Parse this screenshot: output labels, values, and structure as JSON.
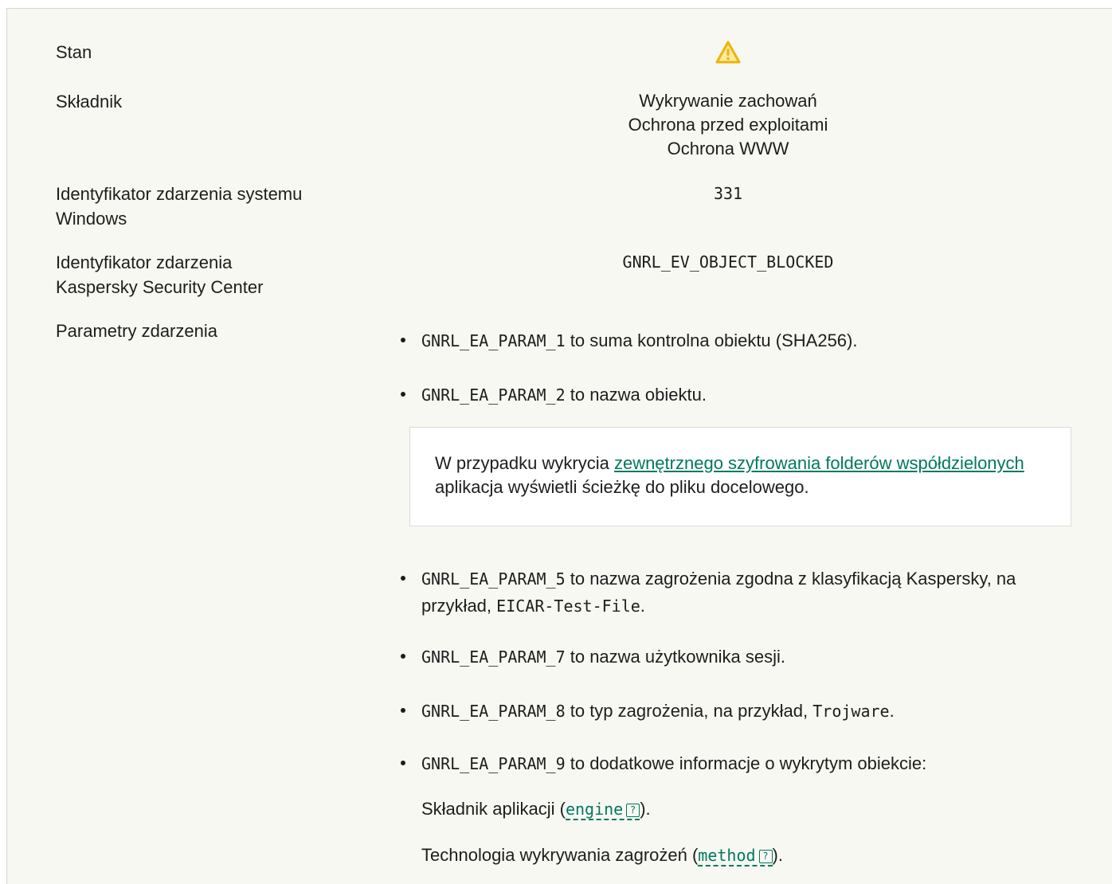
{
  "rows": {
    "stan": {
      "label": "Stan",
      "icon": "warning-icon"
    },
    "skladnik": {
      "label": "Składnik",
      "values": [
        "Wykrywanie zachowań",
        "Ochrona przed exploitami",
        "Ochrona WWW"
      ]
    },
    "windows_id": {
      "label_line1": "Identyfikator zdarzenia systemu",
      "label_line2": "Windows",
      "value": "331"
    },
    "ksc_id": {
      "label_line1": "Identyfikator zdarzenia",
      "label_line2": "Kaspersky Security Center",
      "value": "GNRL_EV_OBJECT_BLOCKED"
    },
    "params": {
      "label": "Parametry zdarzenia"
    }
  },
  "params": {
    "p1": {
      "code": "GNRL_EA_PARAM_1",
      "text": " to suma kontrolna obiektu (SHA256)."
    },
    "p2": {
      "code": "GNRL_EA_PARAM_2",
      "text": " to nazwa obiektu."
    },
    "note": {
      "before": "W przypadku wykrycia ",
      "link": "zewnętrznego szyfrowania folderów współdzielonych",
      "after": " aplikacja wyświetli ścieżkę do pliku docelowego."
    },
    "p5": {
      "code": "GNRL_EA_PARAM_5",
      "text": " to nazwa zagrożenia zgodna z klasyfikacją Kaspersky, na",
      "text2": "przykład, ",
      "example": "EICAR-Test-File",
      "end": "."
    },
    "p7": {
      "code": "GNRL_EA_PARAM_7",
      "text": " to nazwa użytkownika sesji."
    },
    "p8": {
      "code": "GNRL_EA_PARAM_8",
      "text": " to typ zagrożenia, na przykład, ",
      "example": "Trojware",
      "end": "."
    },
    "p9": {
      "code": "GNRL_EA_PARAM_9",
      "text": " to dodatkowe informacje o wykrytym obiekcie:"
    },
    "engine_line": {
      "before": "Składnik aplikacji (",
      "term": "engine",
      "after": ")."
    },
    "method_line": {
      "before": "Technologia wykrywania zagrożeń (",
      "term": "method",
      "after": ")."
    },
    "help_glyph": "?"
  },
  "colors": {
    "accent": "#00785f",
    "warning": "#f0b400",
    "panel_bg": "#f8f8f3"
  }
}
